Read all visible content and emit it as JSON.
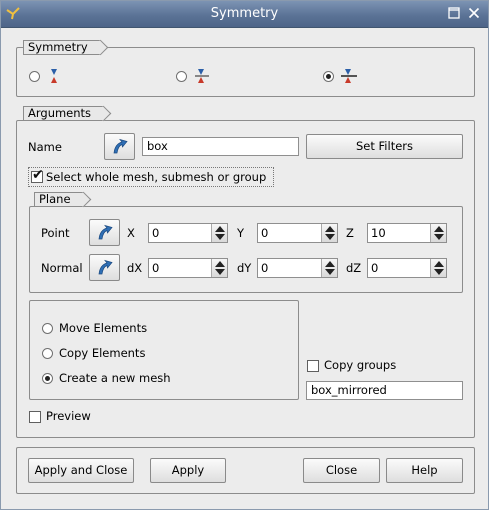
{
  "window": {
    "title": "Symmetry"
  },
  "symmetry": {
    "group_label": "Symmetry",
    "options": [
      {
        "icon": "symmetry-point-icon",
        "checked": false
      },
      {
        "icon": "symmetry-axis-icon",
        "checked": false
      },
      {
        "icon": "symmetry-plane-icon",
        "checked": true
      }
    ]
  },
  "arguments": {
    "group_label": "Arguments",
    "name_label": "Name",
    "name_value": "box",
    "set_filters_label": "Set Filters",
    "select_whole_label": "Select whole mesh, submesh or group",
    "select_whole_checked": true
  },
  "plane": {
    "group_label": "Plane",
    "point_label": "Point",
    "normal_label": "Normal",
    "x_label": "X",
    "y_label": "Y",
    "z_label": "Z",
    "dx_label": "dX",
    "dy_label": "dY",
    "dz_label": "dZ",
    "x": "0",
    "y": "0",
    "z": "10",
    "dx": "0",
    "dy": "0",
    "dz": "0"
  },
  "action": {
    "move_label": "Move Elements",
    "copy_label": "Copy Elements",
    "create_label": "Create a new mesh",
    "selected": "create"
  },
  "copy_groups": {
    "label": "Copy groups",
    "checked": false
  },
  "new_mesh_name": "box_mirrored",
  "preview": {
    "label": "Preview",
    "checked": false
  },
  "buttons": {
    "apply_close": "Apply and Close",
    "apply": "Apply",
    "close": "Close",
    "help": "Help"
  },
  "colors": {
    "titlebar": "#5b7396",
    "dialog_bg": "#ececec",
    "select_icon": "#2f6fb5"
  }
}
